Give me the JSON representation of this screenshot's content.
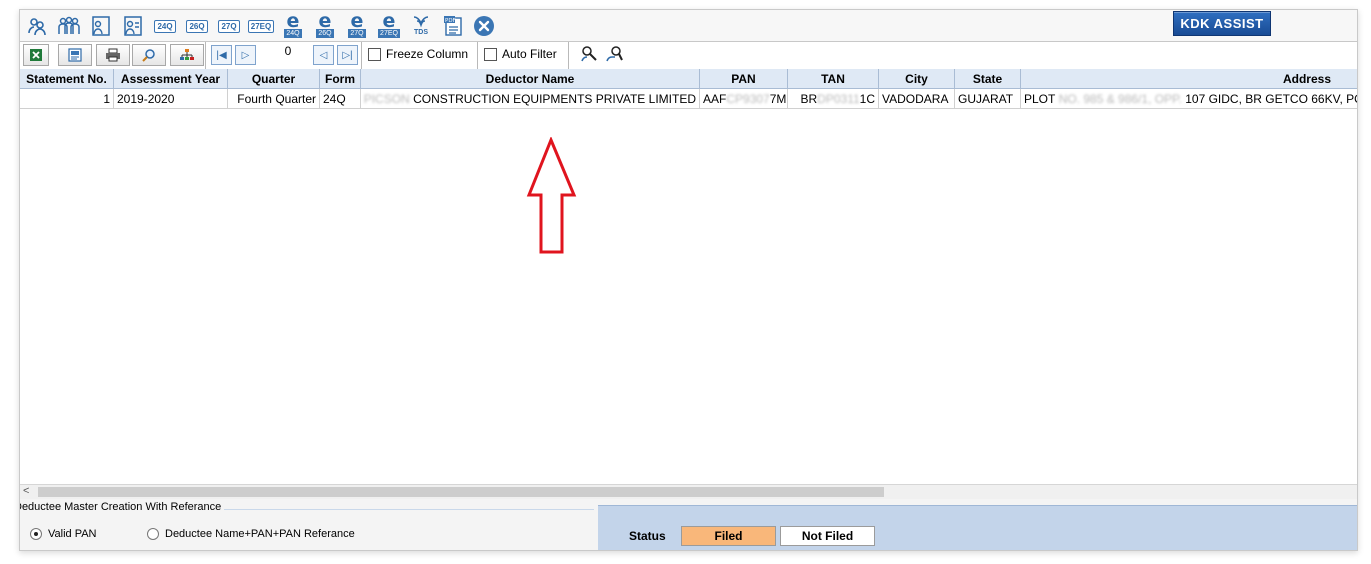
{
  "toolbar": {
    "icons": [
      {
        "name": "deductor-icon",
        "glyph": "👥"
      },
      {
        "name": "deductees-icon",
        "glyph": "👪"
      },
      {
        "name": "person-form-icon",
        "glyph": "🗎"
      },
      {
        "name": "person-list-icon",
        "glyph": "🗎"
      }
    ],
    "forms": [
      "24Q",
      "26Q",
      "27Q",
      "27EQ"
    ],
    "eforms": [
      "24Q",
      "26Q",
      "27Q",
      "27EQ"
    ],
    "tds_label": "TDS",
    "pdf_label": "PDF",
    "kdk_assist": "KDK ASSIST"
  },
  "toolbar2": {
    "page_number": "0",
    "freeze_column": "Freeze Column",
    "auto_filter": "Auto Filter"
  },
  "grid": {
    "headers": [
      "Statement No.",
      "Assessment Year",
      "Quarter",
      "Form",
      "Deductor Name",
      "PAN",
      "TAN",
      "City",
      "State",
      "Address"
    ],
    "rows": [
      {
        "statement_no": "1",
        "assessment_year": "2019-2020",
        "quarter": "Fourth Quarter",
        "form": "24Q",
        "deductor_name_masked": "PICSON",
        "deductor_name": "CONSTRUCTION EQUIPMENTS PRIVATE LIMITED",
        "pan_start": "AAF",
        "pan_masked": "CP9307",
        "pan_end": "7M",
        "tan_start": "BR",
        "tan_masked": "DP0311",
        "tan_end": "1C",
        "city": "VADODARA",
        "state": "GUJARAT",
        "address_start": "PLOT",
        "address_masked": "NO. 985 & 986/1, OPP.",
        "address_end": "107 GIDC, BR GETCO 66KV, PO"
      }
    ]
  },
  "scroll_left_glyph": "<",
  "bottom": {
    "legend": "Deductee Master Creation With Referance",
    "radio_valid_pan": "Valid PAN",
    "radio_name_pan": "Deductee Name+PAN+PAN Referance",
    "status_label": "Status",
    "filed": "Filed",
    "not_filed": "Not Filed"
  },
  "colors": {
    "filed_bg": "#f9b77a",
    "header_bg": "#dfe9f5",
    "status_panel": "#c3d4ea",
    "arrow": "#e0141e"
  }
}
